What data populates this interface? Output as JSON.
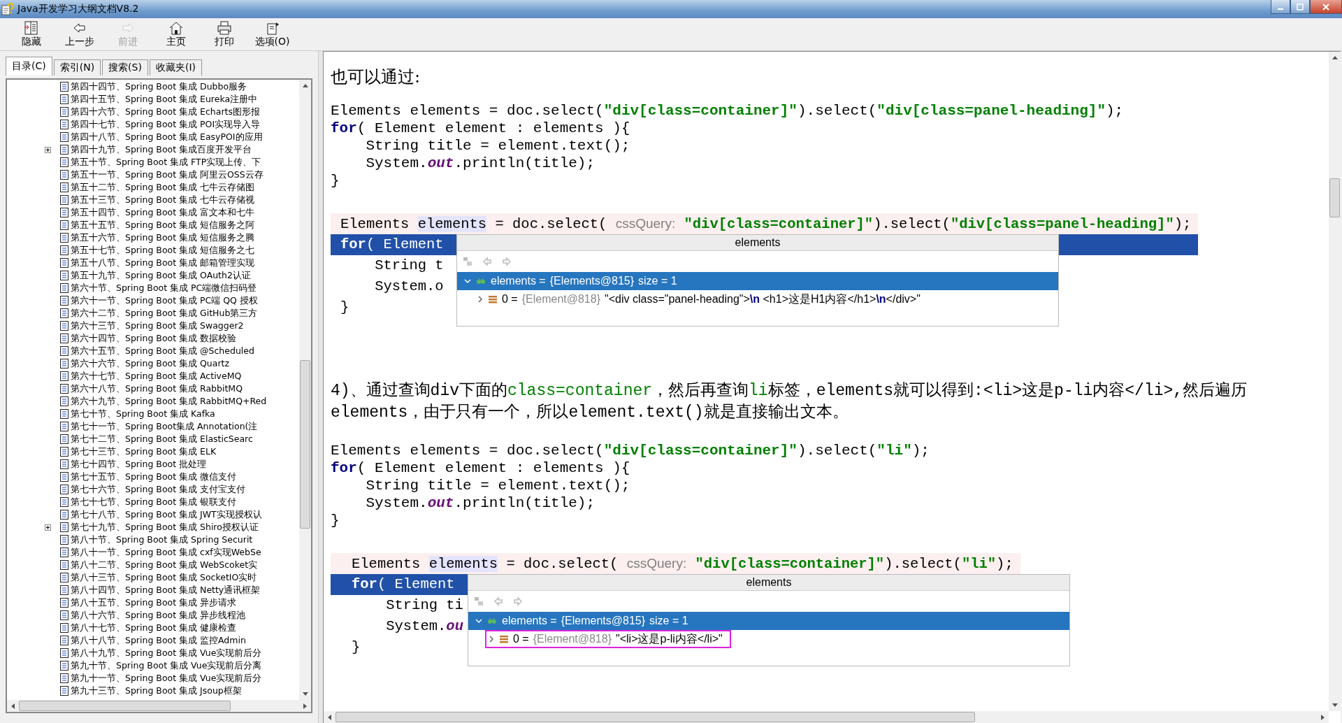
{
  "window": {
    "title": "Java开发学习大纲文档V8.2"
  },
  "toolbar": [
    {
      "label": "隐藏",
      "kind": "hide",
      "disabled": false
    },
    {
      "label": "上一步",
      "kind": "back",
      "disabled": false
    },
    {
      "label": "前进",
      "kind": "forward",
      "disabled": true
    },
    {
      "label": "主页",
      "kind": "home",
      "disabled": false
    },
    {
      "label": "打印",
      "kind": "print",
      "disabled": false
    },
    {
      "label": "选项(O)",
      "kind": "options",
      "disabled": false
    }
  ],
  "tabs": [
    {
      "label": "目录(C)",
      "selected": true
    },
    {
      "label": "索引(N)",
      "selected": false
    },
    {
      "label": "搜索(S)",
      "selected": false
    },
    {
      "label": "收藏夹(I)",
      "selected": false
    }
  ],
  "toc": [
    {
      "label": "第四十四节、Spring Boot 集成 Dubbo服务",
      "kind": "leaf"
    },
    {
      "label": "第四十五节、Spring Boot 集成 Eureka注册中",
      "kind": "leaf"
    },
    {
      "label": "第四十六节、Spring Boot 集成 Echarts图形报",
      "kind": "leaf"
    },
    {
      "label": "第四十七节、Spring Boot 集成 POI实现导入导",
      "kind": "leaf"
    },
    {
      "label": "第四十八节、Spring Boot 集成 EasyPOI的应用",
      "kind": "leaf"
    },
    {
      "label": "第四十九节、Spring Boot 集成百度开发平台",
      "kind": "branch"
    },
    {
      "label": "第五十节、Spring Boot 集成 FTP实现上传、下",
      "kind": "leaf"
    },
    {
      "label": "第五十一节、Spring Boot 集成 阿里云OSS云存",
      "kind": "leaf"
    },
    {
      "label": "第五十二节、Spring Boot 集成 七牛云存储图",
      "kind": "leaf"
    },
    {
      "label": "第五十三节、Spring Boot 集成 七牛云存储视",
      "kind": "leaf"
    },
    {
      "label": "第五十四节、Spring Boot 集成 富文本和七牛",
      "kind": "leaf"
    },
    {
      "label": "第五十五节、Spring Boot 集成 短信服务之阿",
      "kind": "leaf"
    },
    {
      "label": "第五十六节、Spring Boot 集成 短信服务之腾",
      "kind": "leaf"
    },
    {
      "label": "第五十七节、Spring Boot 集成 短信服务之七",
      "kind": "leaf"
    },
    {
      "label": "第五十八节、Spring Boot 集成 邮箱管理实现",
      "kind": "leaf"
    },
    {
      "label": "第五十九节、Spring Boot 集成 OAuth2认证",
      "kind": "leaf"
    },
    {
      "label": "第六十节、Spring Boot 集成 PC端微信扫码登",
      "kind": "leaf"
    },
    {
      "label": "第六十一节、Spring Boot 集成 PC端 QQ 授权",
      "kind": "leaf"
    },
    {
      "label": "第六十二节、Spring Boot 集成 GitHub第三方",
      "kind": "leaf"
    },
    {
      "label": "第六十三节、Spring Boot 集成 Swagger2",
      "kind": "leaf"
    },
    {
      "label": "第六十四节、Spring Boot 集成 数据校验",
      "kind": "leaf"
    },
    {
      "label": "第六十五节、Spring Boot 集成 @Scheduled",
      "kind": "leaf"
    },
    {
      "label": "第六十六节、Spring Boot 集成 Quartz",
      "kind": "leaf"
    },
    {
      "label": "第六十七节、Spring Boot 集成 ActiveMQ",
      "kind": "leaf"
    },
    {
      "label": "第六十八节、Spring Boot 集成 RabbitMQ",
      "kind": "leaf"
    },
    {
      "label": "第六十九节、Spring Boot 集成 RabbitMQ+Red",
      "kind": "leaf"
    },
    {
      "label": "第七十节、Spring Boot 集成 Kafka",
      "kind": "leaf"
    },
    {
      "label": "第七十一节、Spring Boot集成 Annotation(注",
      "kind": "leaf"
    },
    {
      "label": "第七十二节、Spring Boot 集成 ElasticSearc",
      "kind": "leaf"
    },
    {
      "label": "第七十三节、Spring Boot 集成 ELK",
      "kind": "leaf"
    },
    {
      "label": "第七十四节、Spring Boot 批处理",
      "kind": "leaf"
    },
    {
      "label": "第七十五节、Spring Boot 集成 微信支付",
      "kind": "leaf"
    },
    {
      "label": "第七十六节、Spring Boot 集成 支付宝支付",
      "kind": "leaf"
    },
    {
      "label": "第七十七节、Spring Boot 集成 银联支付",
      "kind": "leaf"
    },
    {
      "label": "第七十八节、Spring Boot 集成 JWT实现授权认",
      "kind": "leaf"
    },
    {
      "label": "第七十九节、Spring Boot 集成 Shiro授权认证",
      "kind": "branch"
    },
    {
      "label": "第八十节、Spring Boot 集成 Spring Securit",
      "kind": "leaf"
    },
    {
      "label": "第八十一节、Spring Boot 集成 cxf实现WebSe",
      "kind": "leaf"
    },
    {
      "label": "第八十二节、Spring Boot 集成 WebScoket实",
      "kind": "leaf"
    },
    {
      "label": "第八十三节、Spring Boot 集成 SocketIO实时",
      "kind": "leaf"
    },
    {
      "label": "第八十四节、Spring Boot 集成 Netty通讯框架",
      "kind": "leaf"
    },
    {
      "label": "第八十五节、Spring Boot 集成 异步请求",
      "kind": "leaf"
    },
    {
      "label": "第八十六节、Spring Boot 集成 异步线程池",
      "kind": "leaf"
    },
    {
      "label": "第八十七节、Spring Boot 集成 健康检查",
      "kind": "leaf"
    },
    {
      "label": "第八十八节、Spring Boot 集成 监控Admin",
      "kind": "leaf"
    },
    {
      "label": "第八十九节、Spring Boot 集成 Vue实现前后分",
      "kind": "leaf"
    },
    {
      "label": "第九十节、Spring Boot 集成 Vue实现前后分离",
      "kind": "leaf"
    },
    {
      "label": "第九十一节、Spring Boot 集成 Vue实现前后分",
      "kind": "leaf"
    },
    {
      "label": "第九十三节、Spring Boot 集成 Jsoup框架",
      "kind": "leaf"
    }
  ],
  "content": [
    {
      "kind": "heading",
      "text": "也可以通过:"
    },
    {
      "kind": "code",
      "lines": [
        [
          {
            "kind": "plain",
            "text": "Elements elements = doc.select("
          },
          {
            "kind": "string",
            "text": "\"div[class=container]\""
          },
          {
            "kind": "plain",
            "text": ").select("
          },
          {
            "kind": "string",
            "text": "\"div[class=panel-heading]\""
          },
          {
            "kind": "plain",
            "text": ");"
          }
        ],
        [
          {
            "kind": "keyword",
            "text": "for"
          },
          {
            "kind": "plain",
            "text": "( Element element : elements ){"
          }
        ],
        [
          {
            "kind": "plain",
            "text": "    String title = element.text();"
          }
        ],
        [
          {
            "kind": "plain",
            "text": "    System."
          },
          {
            "kind": "field",
            "text": "out"
          },
          {
            "kind": "plain",
            "text": ".println(title);"
          }
        ],
        [
          {
            "kind": "plain",
            "text": "}"
          }
        ]
      ]
    },
    {
      "kind": "ide",
      "lines": [
        [
          {
            "kind": "plain",
            "text": "Elements "
          },
          {
            "kind": "variable",
            "text": "elements"
          },
          {
            "kind": "plain",
            "text": " = doc.select( "
          },
          {
            "kind": "hint",
            "text": "cssQuery:"
          },
          {
            "kind": "string",
            "text": " \"div[class=container]\""
          },
          {
            "kind": "plain",
            "text": ").select("
          },
          {
            "kind": "string",
            "text": "\"div[class=panel-heading]\""
          },
          {
            "kind": "plain",
            "text": ");"
          }
        ],
        [
          {
            "kind": "keyword",
            "text": "for"
          },
          {
            "kind": "plain",
            "text": "( Element"
          }
        ],
        [
          {
            "kind": "plain",
            "text": "    String t"
          }
        ],
        [
          {
            "kind": "plain",
            "text": "    System.o"
          }
        ],
        [
          {
            "kind": "plain",
            "text": "}"
          }
        ]
      ],
      "popup": {
        "title": "elements",
        "rows": [
          {
            "name": "elements =",
            "type": "{Elements@815}",
            "value": "size = 1",
            "selected": true,
            "expanded": true,
            "outlined": false
          },
          {
            "name": "0 =",
            "type": "{Element@818}",
            "value": "\"<div class=\"panel-heading\">**\\n** <h1>这是H1内容</h1>**\\n**</div>\"",
            "selected": false,
            "expanded": false,
            "outlined": false
          }
        ]
      }
    },
    {
      "kind": "para",
      "segments": [
        {
          "kind": "plain",
          "text": "4)、通过查询div下面的"
        },
        {
          "kind": "green",
          "text": "class=container"
        },
        {
          "kind": "plain",
          "text": "，然后再查询"
        },
        {
          "kind": "green",
          "text": "li"
        },
        {
          "kind": "plain",
          "text": "标签，elements就可以得到:<li>这是p-li内容</li>,然后遍历elements，由于只有一个，所以element.text()就是直接输出文本。"
        }
      ]
    },
    {
      "kind": "code",
      "lines": [
        [
          {
            "kind": "plain",
            "text": "Elements elements = doc.select("
          },
          {
            "kind": "string",
            "text": "\"div[class=container]\""
          },
          {
            "kind": "plain",
            "text": ").select("
          },
          {
            "kind": "string",
            "text": "\"li\""
          },
          {
            "kind": "plain",
            "text": ");"
          }
        ],
        [
          {
            "kind": "keyword",
            "text": "for"
          },
          {
            "kind": "plain",
            "text": "( Element element : elements ){"
          }
        ],
        [
          {
            "kind": "plain",
            "text": "    String title = element.text();"
          }
        ],
        [
          {
            "kind": "plain",
            "text": "    System."
          },
          {
            "kind": "field",
            "text": "out"
          },
          {
            "kind": "plain",
            "text": ".println(title);"
          }
        ],
        [
          {
            "kind": "plain",
            "text": "}"
          }
        ]
      ]
    },
    {
      "kind": "ide",
      "lines": [
        [
          {
            "kind": "plain",
            "text": "Elements "
          },
          {
            "kind": "variable",
            "text": "elements"
          },
          {
            "kind": "plain",
            "text": " = doc.select( "
          },
          {
            "kind": "hint",
            "text": "cssQuery:"
          },
          {
            "kind": "string",
            "text": " \"div[class=container]\""
          },
          {
            "kind": "plain",
            "text": ").select("
          },
          {
            "kind": "string",
            "text": "\"li\""
          },
          {
            "kind": "plain",
            "text": ");"
          }
        ],
        [
          {
            "kind": "keyword",
            "text": "for"
          },
          {
            "kind": "plain",
            "text": "( Element"
          }
        ],
        [
          {
            "kind": "plain",
            "text": "    String ti"
          }
        ],
        [
          {
            "kind": "plain",
            "text": "    System."
          },
          {
            "kind": "field",
            "text": "ou"
          }
        ],
        [
          {
            "kind": "plain",
            "text": "}"
          }
        ]
      ],
      "popup": {
        "title": "elements",
        "rows": [
          {
            "name": "elements =",
            "type": "{Elements@815}",
            "value": "size = 1",
            "selected": true,
            "expanded": true,
            "outlined": false
          },
          {
            "name": "0 =",
            "type": "{Element@818}",
            "value": "\"<li>这是p-li内容</li>\"",
            "selected": false,
            "expanded": false,
            "outlined": true
          }
        ]
      }
    }
  ]
}
